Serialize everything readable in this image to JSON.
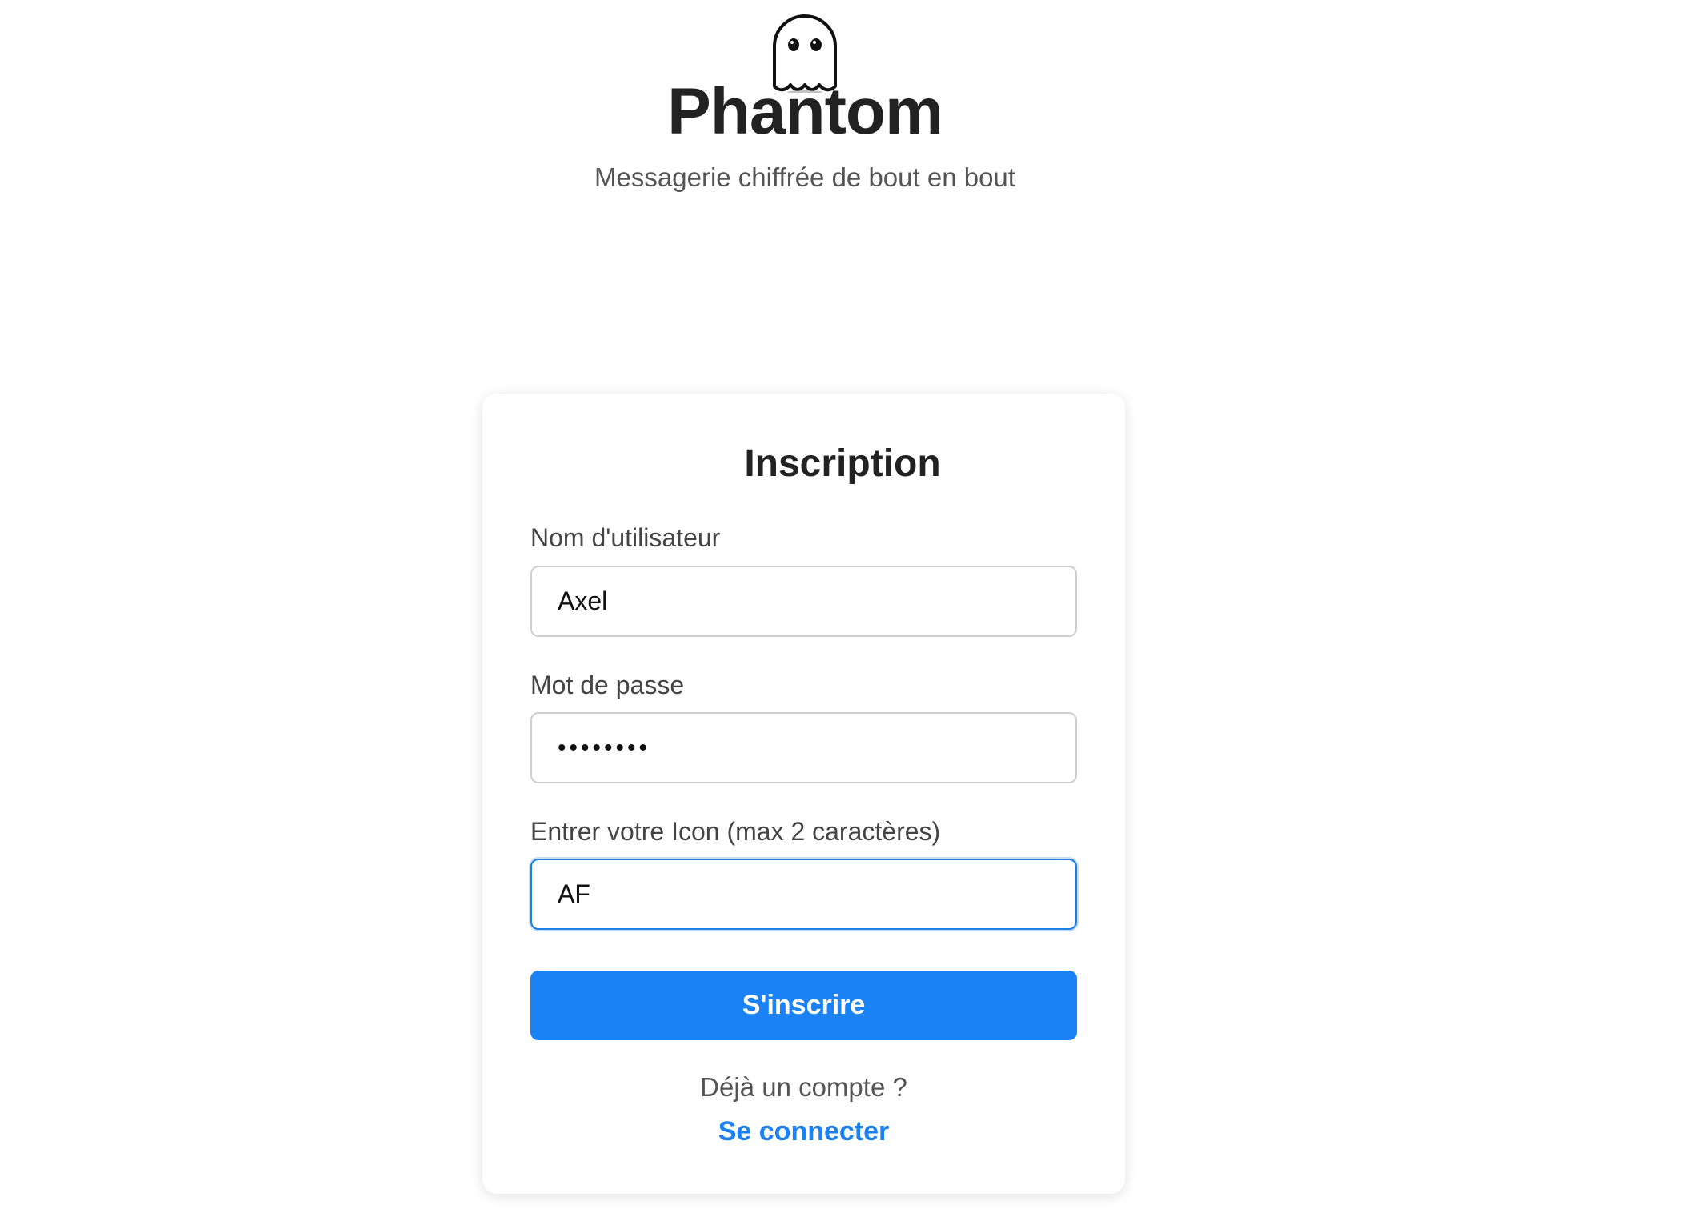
{
  "brand": {
    "logo_icon": "ghost-icon",
    "title": "Phantom",
    "tagline": "Messagerie chiffrée de bout en bout"
  },
  "form": {
    "title": "Inscription",
    "username": {
      "label": "Nom d'utilisateur",
      "value": "Axel"
    },
    "password": {
      "label": "Mot de passe",
      "value": "••••••••"
    },
    "icon": {
      "label": "Entrer votre Icon (max 2 caractères)",
      "value": "AF"
    },
    "submit_label": "S'inscrire",
    "already_text": "Déjà un compte ?",
    "login_link": "Se connecter"
  },
  "colors": {
    "accent": "#1a82f5",
    "focus_border": "#1a7ee6",
    "text_dark": "#222222",
    "text_muted": "#555555"
  }
}
